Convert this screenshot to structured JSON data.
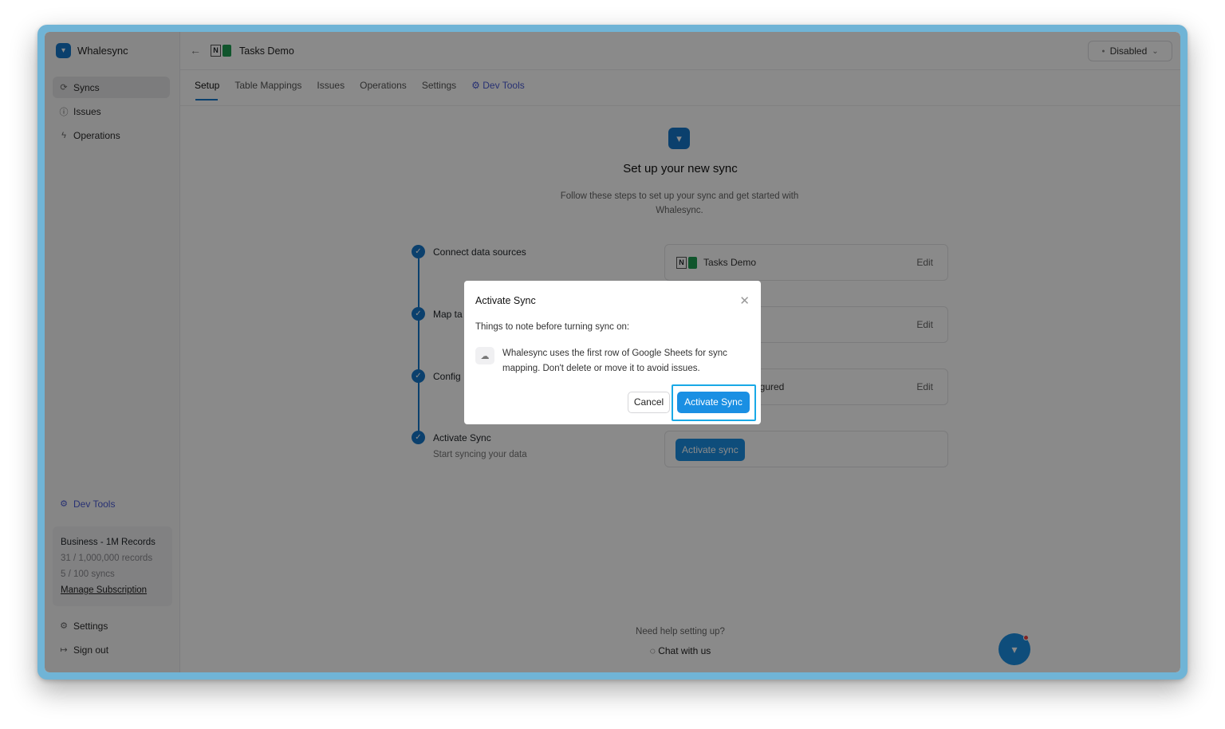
{
  "app": {
    "name": "Whalesync"
  },
  "sidebar": {
    "items": [
      {
        "label": "Syncs",
        "icon": "sync-icon",
        "active": true
      },
      {
        "label": "Issues",
        "icon": "info-icon"
      },
      {
        "label": "Operations",
        "icon": "bolt-icon"
      }
    ],
    "dev_tools": "Dev Tools",
    "plan": {
      "name": "Business - 1M Records",
      "records": "31 / 1,000,000 records",
      "syncs": "5 / 100 syncs",
      "manage": "Manage Subscription"
    },
    "settings": "Settings",
    "sign_out": "Sign out"
  },
  "header": {
    "title": "Tasks Demo",
    "status": "Disabled"
  },
  "tabs": [
    "Setup",
    "Table Mappings",
    "Issues",
    "Operations",
    "Settings",
    "Dev Tools"
  ],
  "setup": {
    "title": "Set up your new sync",
    "subtitle": "Follow these steps to set up your sync and get started with Whalesync.",
    "steps": [
      {
        "label": "Connect data sources",
        "card_text": "Tasks Demo",
        "edit": "Edit"
      },
      {
        "label": "Map ta",
        "edit": "Edit"
      },
      {
        "label": "Config",
        "card_text": "igured",
        "edit": "Edit"
      },
      {
        "label": "Activate Sync",
        "sub": "Start syncing your data",
        "button": "Activate sync"
      }
    ],
    "help": "Need help setting up?",
    "chat": "Chat with us"
  },
  "modal": {
    "title": "Activate Sync",
    "note": "Things to note before turning sync on:",
    "item": "Whalesync uses the first row of Google Sheets for sync mapping. Don't delete or move it to avoid issues.",
    "cancel": "Cancel",
    "confirm": "Activate Sync"
  },
  "colors": {
    "accent": "#1a8fe3",
    "brand": "#1677c9",
    "highlight": "#19a9e6"
  }
}
